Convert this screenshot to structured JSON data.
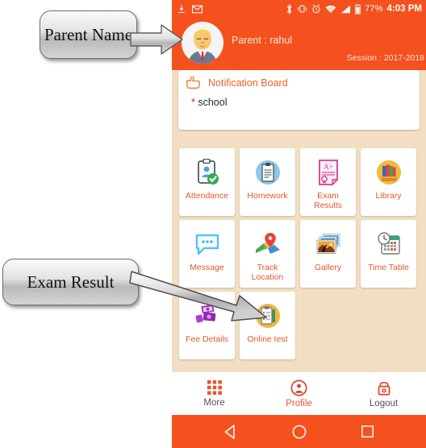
{
  "statusbar": {
    "left_icons": [
      "download-icon",
      "gmail-icon"
    ],
    "right_icons": [
      "bluetooth-icon",
      "vibrate-icon",
      "alarm-icon",
      "wifi-icon",
      "signal-icon",
      "battery-icon"
    ],
    "battery": "77%",
    "time": "4:03 PM"
  },
  "header": {
    "avatar": "parent-avatar",
    "parent_label": "Parent : rahul",
    "session_label": "Session : 2017-2018",
    "background_color": "#f4511e"
  },
  "notification": {
    "icon": "pointing-hand-icon",
    "title": "Notification Board",
    "items": [
      "school"
    ],
    "bullet": "*"
  },
  "grid": {
    "tiles": [
      {
        "label": "Attendance",
        "icon": "clipboard-check-icon"
      },
      {
        "label": "Homework",
        "icon": "clipboard-circle-icon"
      },
      {
        "label": "Exam Results",
        "icon": "grade-paper-icon"
      },
      {
        "label": "Library",
        "icon": "books-icon"
      },
      {
        "label": "Message",
        "icon": "chat-bubble-icon"
      },
      {
        "label": "Track Location",
        "icon": "map-pin-icon"
      },
      {
        "label": "Gallery",
        "icon": "photos-icon"
      },
      {
        "label": "Time Table",
        "icon": "calendar-clock-icon"
      },
      {
        "label": "Fee Details",
        "icon": "money-icon"
      },
      {
        "label": "Online test",
        "icon": "checklist-icon"
      }
    ],
    "label_color": "#e4572e"
  },
  "bottom_nav": [
    {
      "label": "More",
      "icon": "grid-icon"
    },
    {
      "label": "Profile",
      "icon": "person-circle-icon"
    },
    {
      "label": "Logout",
      "icon": "lock-icon"
    }
  ],
  "system_nav": [
    {
      "icon": "back-triangle-icon"
    },
    {
      "icon": "home-circle-icon"
    },
    {
      "icon": "recents-square-icon"
    }
  ],
  "annotations": {
    "parent_name": "Parent Name",
    "exam_result": "Exam Result"
  }
}
